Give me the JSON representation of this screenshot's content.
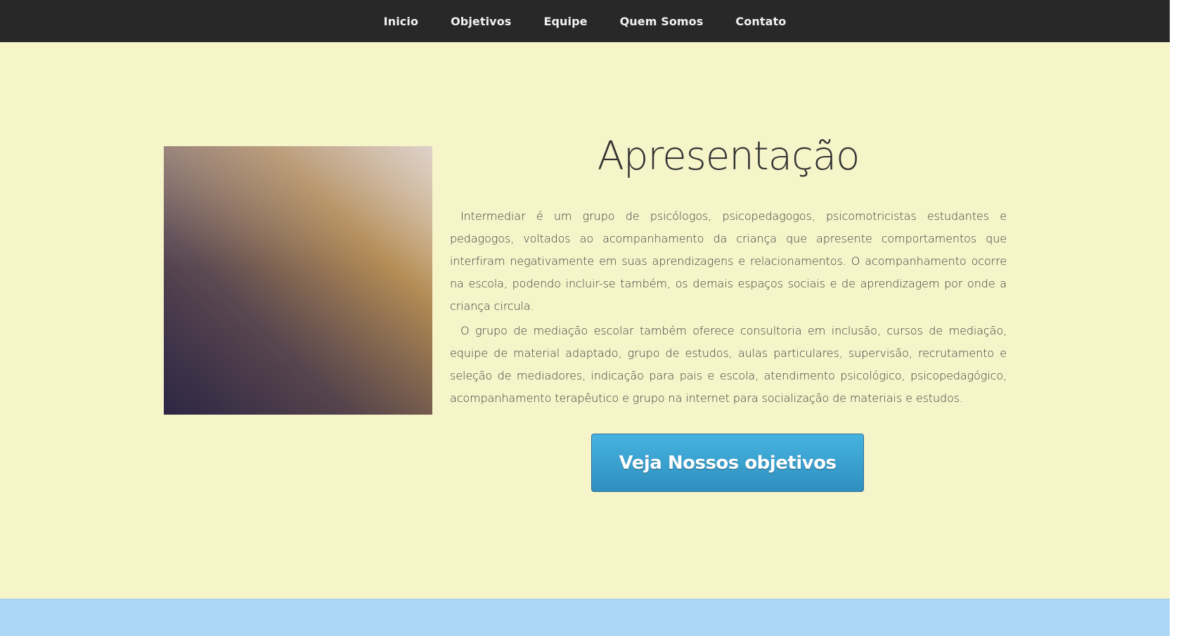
{
  "nav": {
    "items": [
      "Inicio",
      "Objetivos",
      "Equipe",
      "Quem Somos",
      "Contato"
    ]
  },
  "intro": {
    "heading": "Apresentação",
    "paragraph1": "Intermediar é um grupo de psicólogos, psicopedagogos, psicomotricistas estudantes e pedagogos, voltados ao acompanhamento da criança que apresente comportamentos que interfiram negativamente em suas aprendizagens e relacionamentos. O acompanhamento ocorre na escola, podendo incluir-se também, os demais espaços sociais e de aprendizagem por onde a criança circula.",
    "paragraph2": "O grupo de mediação escolar também oferece consultoria em inclusão, cursos de mediação, equipe de material adaptado, grupo de estudos, aulas particulares, supervisão, recrutamento e seleção de mediadores, indicação para pais e escola, atendimento psicológico, psicopedagógico, acompanhamento terapêutico e grupo na internet para socialização de materiais e estudos.",
    "cta_label": "Veja Nossos objetivos"
  },
  "colors": {
    "nav_bg": "#282828",
    "main_bg": "#f6f4c9",
    "bottom_bg": "#acd7f6",
    "button": "#3aa0d0"
  }
}
